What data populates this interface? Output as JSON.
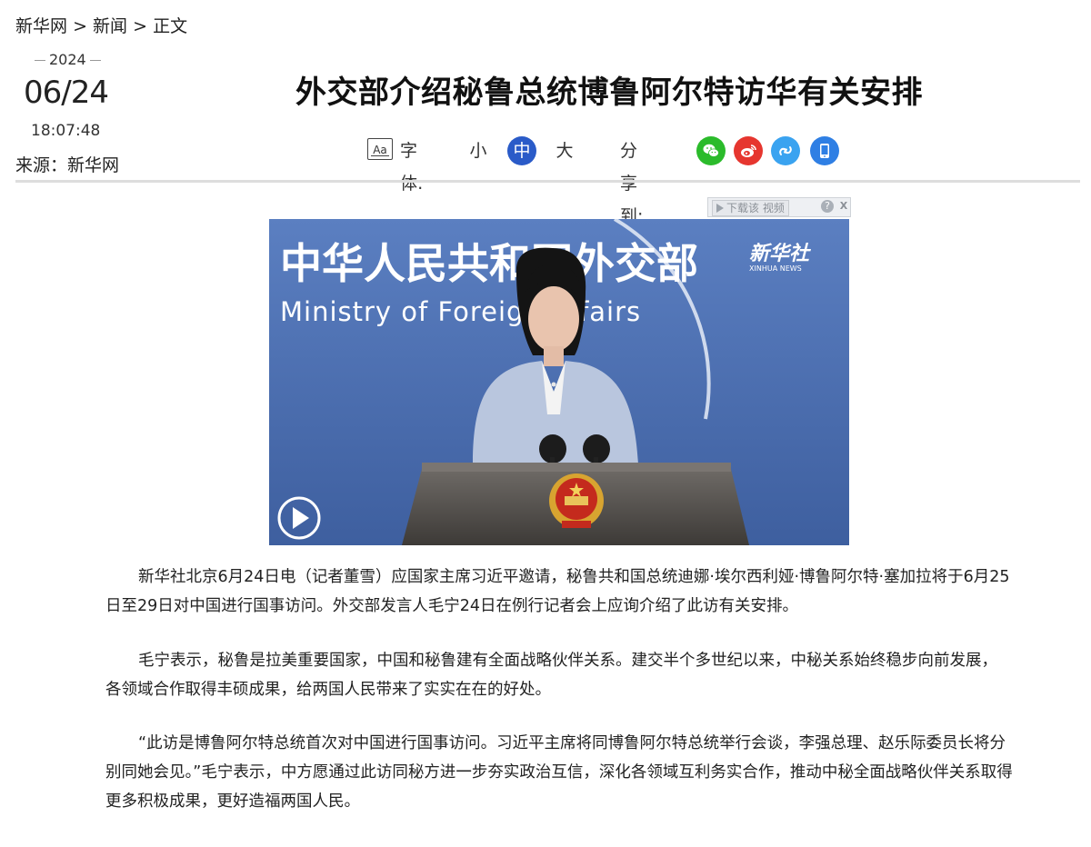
{
  "breadcrumb": {
    "site": "新华网",
    "sep": ">",
    "section": "新闻",
    "current": "正文"
  },
  "date": {
    "year": "2024",
    "day": "06/24",
    "time": "18:07:48"
  },
  "source": "来源：新华网",
  "title": "外交部介绍秘鲁总统博鲁阿尔特访华有关安排",
  "toolbar": {
    "font_icon": "Aa",
    "font_label": "字体:",
    "sizes": [
      "小",
      "中",
      "大"
    ],
    "active_size": "中",
    "share_label": "分享到:",
    "share": [
      {
        "name": "wechat-icon",
        "color": "#2bbb2b"
      },
      {
        "name": "weibo-icon",
        "color": "#e6362f"
      },
      {
        "name": "link-icon",
        "color": "#3aa3f0"
      },
      {
        "name": "mobile-icon",
        "color": "#2f7fe4"
      }
    ]
  },
  "video": {
    "download_label": "下载该 视频",
    "help": "?",
    "close": "X",
    "backdrop_cn": "中华人民共和国外交部",
    "backdrop_en": "Ministry of Foreign Affairs",
    "watermark_cn": "新华社",
    "watermark_en": "XINHUA NEWS"
  },
  "article": {
    "paragraphs": [
      "新华社北京6月24日电（记者董雪）应国家主席习近平邀请，秘鲁共和国总统迪娜·埃尔西利娅·博鲁阿尔特·塞加拉将于6月25日至29日对中国进行国事访问。外交部发言人毛宁24日在例行记者会上应询介绍了此访有关安排。",
      "毛宁表示，秘鲁是拉美重要国家，中国和秘鲁建有全面战略伙伴关系。建交半个多世纪以来，中秘关系始终稳步向前发展，各领域合作取得丰硕成果，给两国人民带来了实实在在的好处。",
      "“此访是博鲁阿尔特总统首次对中国进行国事访问。习近平主席将同博鲁阿尔特总统举行会谈，李强总理、赵乐际委员长将分别同她会见。”毛宁表示，中方愿通过此访同秘方进一步夯实政治互信，深化各领域互利务实合作，推动中秘全面战略伙伴关系取得更多积极成果，更好造福两国人民。"
    ]
  }
}
